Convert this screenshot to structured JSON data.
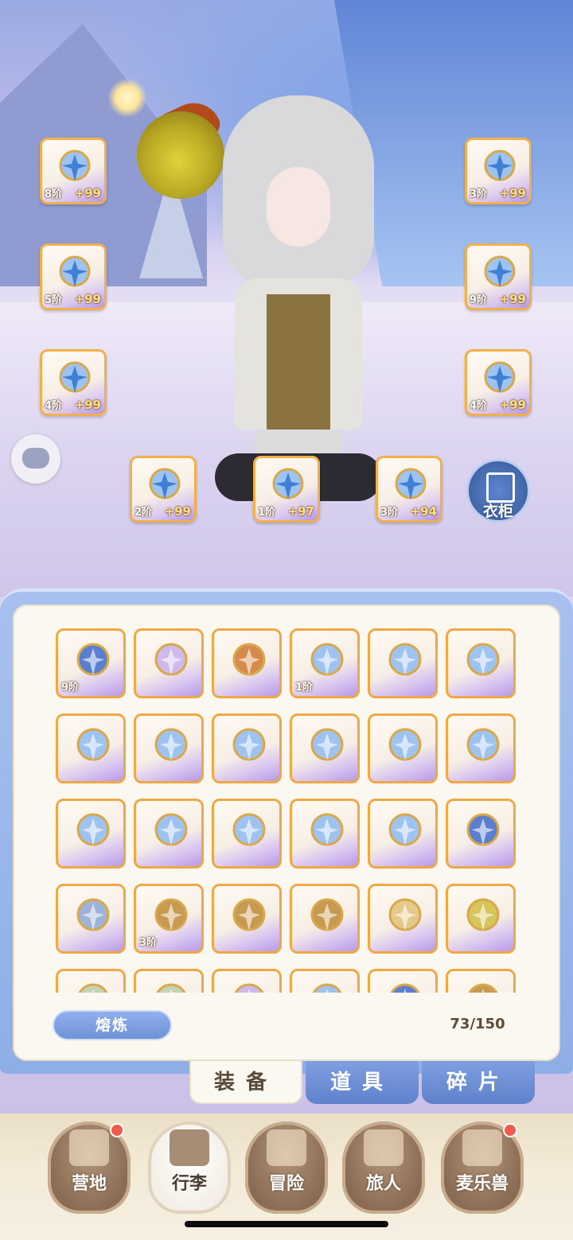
{
  "equip_slots": [
    {
      "id": "slot-weapon",
      "tier": "8阶",
      "plus": "+99",
      "icon": "crystal-staff-icon"
    },
    {
      "id": "slot-helmet",
      "tier": "3阶",
      "plus": "+99",
      "icon": "helmet-icon"
    },
    {
      "id": "slot-armor",
      "tier": "5阶",
      "plus": "+99",
      "icon": "chest-armor-icon"
    },
    {
      "id": "slot-gauntlet",
      "tier": "9阶",
      "plus": "+99",
      "icon": "gauntlet-icon"
    },
    {
      "id": "slot-pants",
      "tier": "4阶",
      "plus": "+99",
      "icon": "leg-armor-icon"
    },
    {
      "id": "slot-boots",
      "tier": "4阶",
      "plus": "+99",
      "icon": "boots-icon"
    },
    {
      "id": "slot-ring",
      "tier": "2阶",
      "plus": "+99",
      "icon": "ring-icon"
    },
    {
      "id": "slot-necklace",
      "tier": "1阶",
      "plus": "+97",
      "icon": "necklace-icon"
    },
    {
      "id": "slot-charm",
      "tier": "3阶",
      "plus": "+94",
      "icon": "horn-charm-icon"
    }
  ],
  "wardrobe_label": "衣柜",
  "inventory": {
    "items": [
      {
        "icon": "helmet-icon",
        "tier": "9阶"
      },
      {
        "icon": "orb-icon",
        "tier": ""
      },
      {
        "icon": "horn-charm-icon",
        "tier": ""
      },
      {
        "icon": "crystal-staff-icon",
        "tier": "1阶"
      },
      {
        "icon": "crystal-staff-icon",
        "tier": ""
      },
      {
        "icon": "crystal-staff-icon",
        "tier": ""
      },
      {
        "icon": "crystal-staff-icon",
        "tier": ""
      },
      {
        "icon": "crystal-staff-icon",
        "tier": ""
      },
      {
        "icon": "crystal-staff-icon",
        "tier": ""
      },
      {
        "icon": "crystal-staff-icon",
        "tier": ""
      },
      {
        "icon": "crystal-staff-icon",
        "tier": ""
      },
      {
        "icon": "crystal-staff-icon",
        "tier": ""
      },
      {
        "icon": "crystal-staff-icon",
        "tier": ""
      },
      {
        "icon": "crystal-staff-icon",
        "tier": ""
      },
      {
        "icon": "crystal-staff-icon",
        "tier": ""
      },
      {
        "icon": "crystal-staff-icon",
        "tier": ""
      },
      {
        "icon": "crystal-staff-icon",
        "tier": ""
      },
      {
        "icon": "helmet-icon",
        "tier": ""
      },
      {
        "icon": "chest-armor-icon",
        "tier": ""
      },
      {
        "icon": "gauntlet-icon",
        "tier": "3阶"
      },
      {
        "icon": "gauntlet-icon",
        "tier": ""
      },
      {
        "icon": "gauntlet-icon",
        "tier": ""
      },
      {
        "icon": "boots-icon",
        "tier": ""
      },
      {
        "icon": "ring-icon",
        "tier": ""
      },
      {
        "icon": "necklace-icon",
        "tier": ""
      },
      {
        "icon": "necklace-icon",
        "tier": ""
      },
      {
        "icon": "orb-icon",
        "tier": ""
      },
      {
        "icon": "crystal-staff-icon",
        "tier": ""
      },
      {
        "icon": "helmet-icon",
        "tier": ""
      },
      {
        "icon": "gauntlet-icon",
        "tier": ""
      }
    ],
    "smelt_label": "熔炼",
    "capacity": "73/150"
  },
  "tabs": [
    {
      "label": "装备",
      "active": true
    },
    {
      "label": "道具",
      "active": false
    },
    {
      "label": "碎片",
      "active": false
    }
  ],
  "nav": [
    {
      "label": "营地",
      "active": false,
      "badge": true,
      "icon": "castle-icon"
    },
    {
      "label": "行李",
      "active": true,
      "badge": false,
      "icon": "backpack-icon"
    },
    {
      "label": "冒险",
      "active": false,
      "badge": false,
      "icon": "crossed-swords-icon"
    },
    {
      "label": "旅人",
      "active": false,
      "badge": false,
      "icon": "traveler-icon"
    },
    {
      "label": "麦乐兽",
      "active": false,
      "badge": true,
      "icon": "pet-icon"
    }
  ],
  "colors": {
    "slot_border": "#f2b04c",
    "tab_active": "#fbf8f1",
    "tab_inactive": "#6f92d8",
    "badge": "#ee5b4c"
  }
}
